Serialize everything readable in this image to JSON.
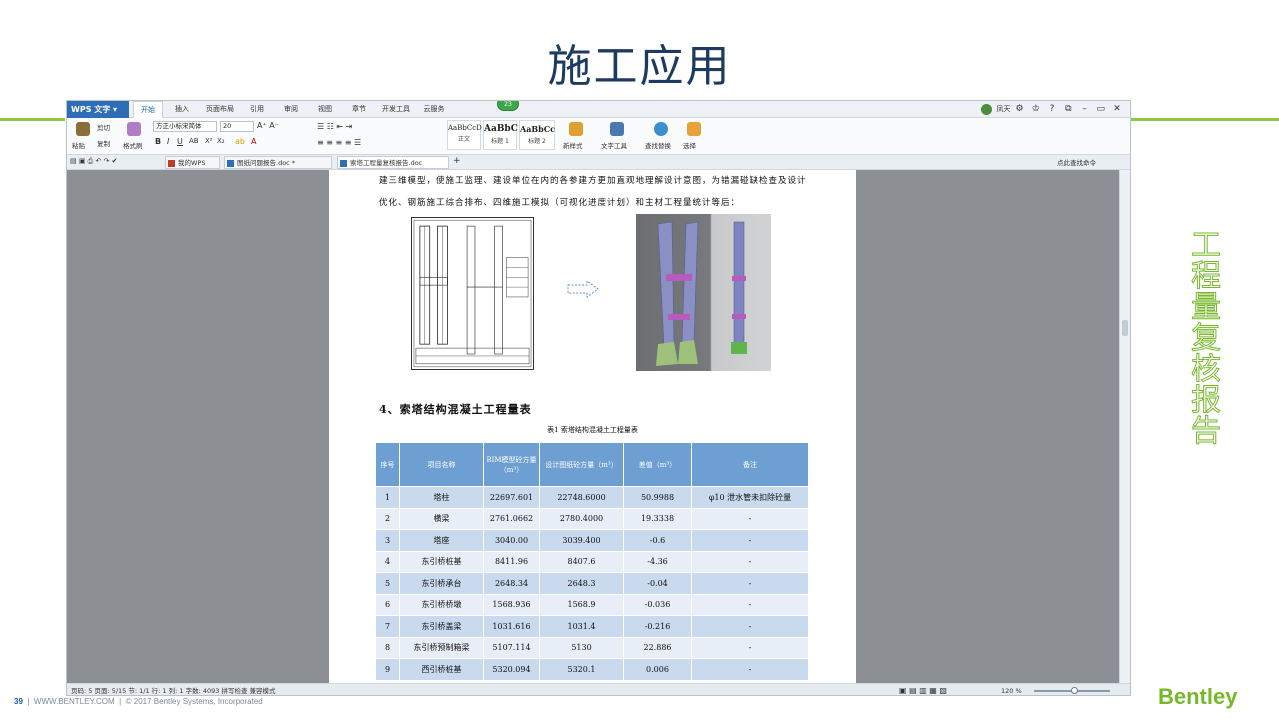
{
  "slide": {
    "title": "施工应用",
    "side_label": "工程量复核报告",
    "page_number": "39",
    "footer_site": "WWW.BENTLEY.COM",
    "footer_copyright": "© 2017 Bentley Systems, Incorporated",
    "brand": "Bentley"
  },
  "wps": {
    "app_name": "WPS 文字",
    "menu_tabs": [
      "开始",
      "插入",
      "页面布局",
      "引用",
      "审阅",
      "视图",
      "章节",
      "开发工具",
      "云服务"
    ],
    "notification_count": "23",
    "user_name": "凤天",
    "ribbon": {
      "paste": "粘贴",
      "cut": "剪切",
      "copy": "复制",
      "format_painter": "格式刷",
      "font_name": "方正小标宋简体",
      "font_size": "20",
      "styles": [
        {
          "sample": "AaBbCcD",
          "name": "正文"
        },
        {
          "sample": "AaBbC",
          "name": "标题 1"
        },
        {
          "sample": "AaBbCc",
          "name": "标题 2"
        }
      ],
      "new_style": "新样式",
      "text_tools": "文字工具",
      "find_replace": "查找替换",
      "select": "选择"
    },
    "tabs": [
      {
        "label": "我的WPS"
      },
      {
        "label": "图纸问题报告.doc *"
      },
      {
        "label": "索塔工程量复核报告.doc"
      }
    ],
    "tabbar_right": "点此查找命令",
    "document": {
      "paragraph": "建三维模型，使施工监理、建设单位在内的各参建方更加直观地理解设计意图，为错漏碰缺检查及设计优化、钢筋施工综合排布、四维施工模拟（可视化进度计划）和主材工程量统计等后：",
      "heading": "4、索塔结构混凝土工程量表",
      "caption": "表1   索塔结构混凝土工程量表",
      "columns": [
        "序号",
        "项目名称",
        "BIM模型砼方量（m³）",
        "设计图纸砼方量（m³）",
        "差值（m³）",
        "备注"
      ],
      "rows": [
        [
          "1",
          "塔柱",
          "22697.601",
          "22748.6000",
          "50.9988",
          "φ10 泄水管未扣除砼量"
        ],
        [
          "2",
          "横梁",
          "2761.0662",
          "2780.4000",
          "19.3338",
          "-"
        ],
        [
          "3",
          "塔座",
          "3040.00",
          "3039.400",
          "-0.6",
          "-"
        ],
        [
          "4",
          "东引桥桩基",
          "8411.96",
          "8407.6",
          "-4.36",
          "-"
        ],
        [
          "5",
          "东引桥承台",
          "2648.34",
          "2648.3",
          "-0.04",
          "-"
        ],
        [
          "6",
          "东引桥桥墩",
          "1568.936",
          "1568.9",
          "-0.036",
          "-"
        ],
        [
          "7",
          "东引桥盖梁",
          "1031.616",
          "1031.4",
          "-0.216",
          "-"
        ],
        [
          "8",
          "东引桥预制箱梁",
          "5107.114",
          "5130",
          "22.886",
          "-"
        ],
        [
          "9",
          "西引桥桩基",
          "5320.094",
          "5320.1",
          "0.006",
          "-"
        ]
      ]
    },
    "status": {
      "left": "页码: 5   页面: 5/15   节: 1/1   行: 1   列: 1   字数: 4093   拼写检查   兼容模式",
      "zoom": "120 %"
    }
  }
}
